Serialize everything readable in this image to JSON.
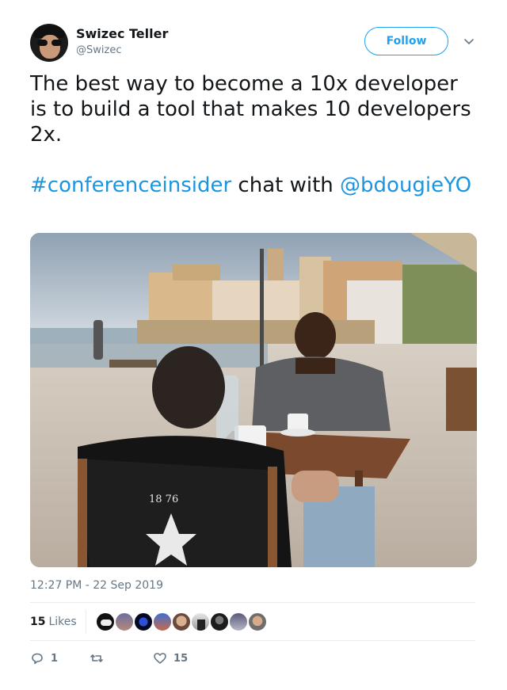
{
  "user": {
    "name": "Swizec Teller",
    "handle": "@Swizec"
  },
  "follow_label": "Follow",
  "tweet": {
    "line1": "The best way to become a 10x developer is to build a tool that makes 10 developers 2x.",
    "hashtag": "#conferenceinsider",
    "mid_text": " chat with ",
    "mention": "@bdougieYO"
  },
  "photo": {
    "jersey_text": "18 76"
  },
  "timestamp": "12:27 PM - 22 Sep 2019",
  "likes": {
    "count": "15",
    "label": "Likes"
  },
  "actions": {
    "reply_count": "1",
    "retweet_count": "",
    "like_count": "15"
  },
  "colors": {
    "accent": "#1da1f2",
    "link": "#1b95e0",
    "muted": "#657786",
    "heart": "#657786"
  }
}
